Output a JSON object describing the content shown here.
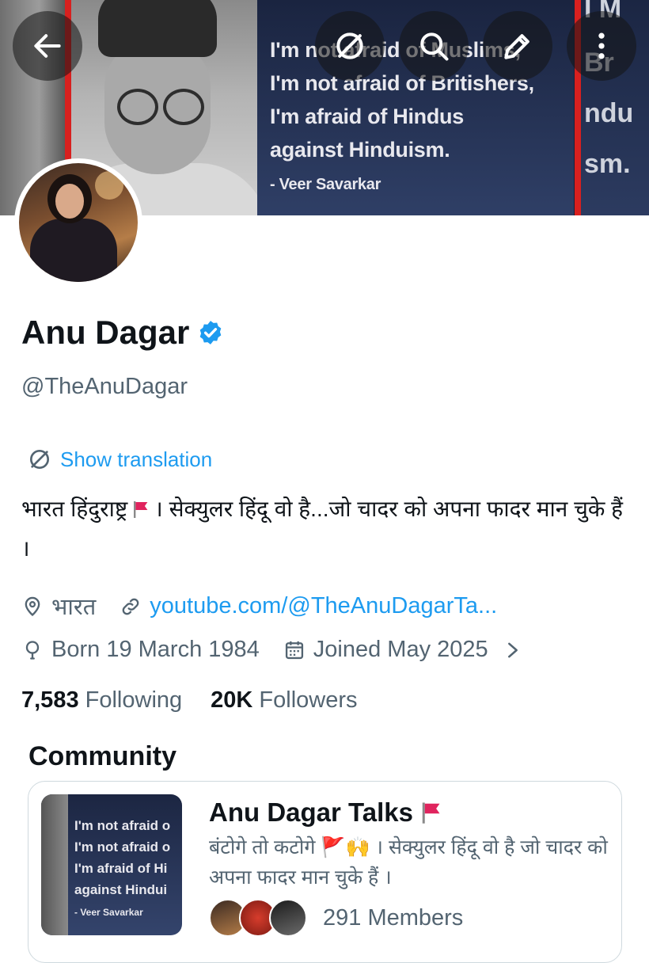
{
  "banner": {
    "quote_lines": [
      "I'm not afraid of Muslims,",
      "I'm not afraid of Britishers,",
      "I'm afraid of Hindus",
      "against Hinduism."
    ],
    "quote_attribution": "- Veer Savarkar",
    "right_partial_text": [
      "I M",
      "Br",
      "ndu",
      "sm."
    ]
  },
  "profile": {
    "name": "Anu Dagar",
    "verified": true,
    "handle": "@TheAnuDagar",
    "show_translation": "Show translation",
    "bio_part1": "भारत हिंदुराष्ट्र",
    "bio_part2": "। सेक्युलर हिंदू वो है...जो चादर को अपना फादर मान चुके हैं ।",
    "location": "भारत",
    "website": "youtube.com/@TheAnuDagarTa...",
    "born": "Born 19 March 1984",
    "joined": "Joined May 2025"
  },
  "stats": {
    "following_count": "7,583",
    "following_label": "Following",
    "followers_count": "20K",
    "followers_label": "Followers"
  },
  "community": {
    "section_title": "Community",
    "name": "Anu Dagar Talks",
    "description": "बंटोगे तो कटोगे 🚩🙌 । सेक्युलर हिंदू वो है जो चादर को अपना फादर मान चुके हैं ।",
    "members": "291 Members",
    "thumb_lines": [
      "I'm not afraid o",
      "I'm not afraid o",
      "I'm afraid of Hi",
      "against Hindui",
      "- Veer Savarkar"
    ]
  },
  "colors": {
    "accent": "#1d9bf0",
    "secondary_text": "#536471",
    "flag": "#e0245e"
  },
  "icons": [
    "back-arrow-icon",
    "translate-icon",
    "search-icon",
    "compose-icon",
    "more-icon",
    "verified-badge-icon",
    "location-icon",
    "link-icon",
    "birthday-icon",
    "calendar-icon",
    "chevron-right-icon",
    "flag-icon"
  ]
}
